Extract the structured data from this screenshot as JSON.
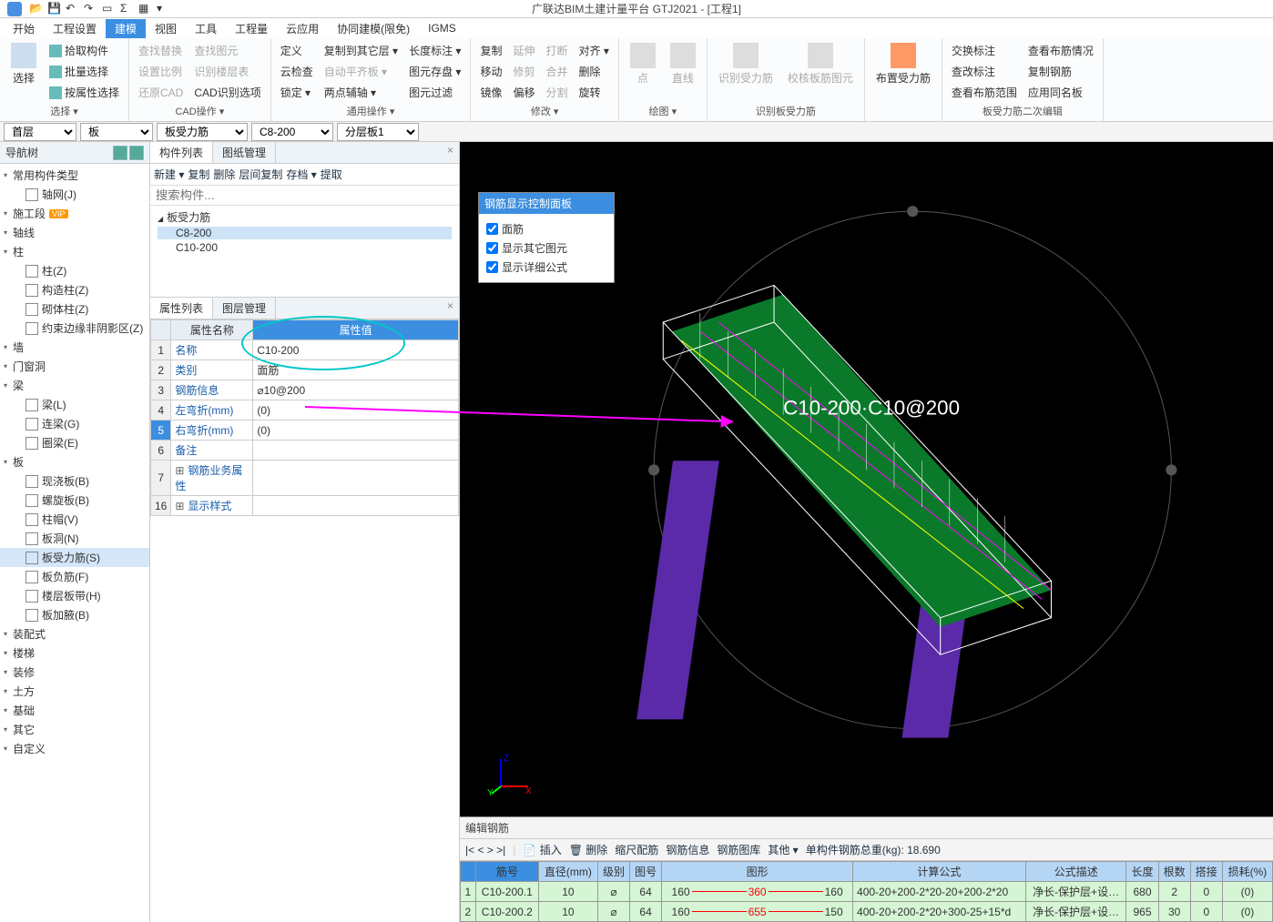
{
  "app": {
    "title": "广联达BIM土建计量平台 GTJ2021 - [工程1]"
  },
  "menus": [
    "开始",
    "工程设置",
    "建模",
    "视图",
    "工具",
    "工程量",
    "云应用",
    "协同建模(限免)",
    "IGMS"
  ],
  "menu_active": 2,
  "ribbon": {
    "select": {
      "big": "选择",
      "items": [
        "拾取构件",
        "批量选择",
        "按属性选择"
      ],
      "label": "选择 ▾"
    },
    "cad": {
      "items": [
        "查找替换",
        "设置比例",
        "还原CAD",
        "查找图元",
        "识别楼层表",
        "CAD识别选项"
      ],
      "label": "CAD操作 ▾"
    },
    "general": {
      "items": [
        "定义",
        "云检查",
        "锁定 ▾",
        "复制到其它层 ▾",
        "自动平齐板 ▾",
        "两点辅轴 ▾",
        "长度标注 ▾",
        "图元存盘 ▾",
        "图元过滤"
      ],
      "label": "通用操作 ▾"
    },
    "modify": {
      "items": [
        "复制",
        "移动",
        "镜像",
        "延伸",
        "修剪",
        "偏移",
        "打断",
        "合并",
        "分割",
        "对齐 ▾",
        "删除",
        "旋转"
      ],
      "label": "修改 ▾"
    },
    "draw": {
      "items": [
        "点",
        "直线"
      ],
      "label": "绘图 ▾"
    },
    "recog": {
      "items": [
        "识别受力筋",
        "校核板筋图元"
      ],
      "label": "识别板受力筋"
    },
    "layout": {
      "big": "布置受力筋"
    },
    "edit2": {
      "items": [
        "交换标注",
        "查看布筋情况",
        "查改标注",
        "复制钢筋",
        "查看布筋范围",
        "应用同名板"
      ],
      "label": "板受力筋二次编辑"
    }
  },
  "selectors": {
    "floor": "首层",
    "cat": "板",
    "type": "板受力筋",
    "spec": "C8-200",
    "layer": "分层板1"
  },
  "nav": {
    "title": "导航树",
    "groups": [
      {
        "name": "常用构件类型",
        "items": [
          {
            "label": "轴网(J)"
          }
        ]
      },
      {
        "name": "施工段",
        "vip": true,
        "items": []
      },
      {
        "name": "轴线",
        "items": []
      },
      {
        "name": "柱",
        "items": [
          {
            "label": "柱(Z)"
          },
          {
            "label": "构造柱(Z)"
          },
          {
            "label": "砌体柱(Z)"
          },
          {
            "label": "约束边缘非阴影区(Z)"
          }
        ]
      },
      {
        "name": "墙",
        "items": []
      },
      {
        "name": "门窗洞",
        "items": []
      },
      {
        "name": "梁",
        "items": [
          {
            "label": "梁(L)"
          },
          {
            "label": "连梁(G)"
          },
          {
            "label": "圈梁(E)"
          }
        ]
      },
      {
        "name": "板",
        "items": [
          {
            "label": "现浇板(B)"
          },
          {
            "label": "螺旋板(B)"
          },
          {
            "label": "柱帽(V)"
          },
          {
            "label": "板洞(N)"
          },
          {
            "label": "板受力筋(S)",
            "selected": true
          },
          {
            "label": "板负筋(F)"
          },
          {
            "label": "楼层板带(H)"
          },
          {
            "label": "板加腋(B)"
          }
        ]
      },
      {
        "name": "装配式",
        "items": []
      },
      {
        "name": "楼梯",
        "items": []
      },
      {
        "name": "装修",
        "items": []
      },
      {
        "name": "土方",
        "items": []
      },
      {
        "name": "基础",
        "items": []
      },
      {
        "name": "其它",
        "items": []
      },
      {
        "name": "自定义",
        "items": []
      }
    ]
  },
  "complist": {
    "tabs": [
      "构件列表",
      "图纸管理"
    ],
    "toolbar": [
      "新建 ▾",
      "复制",
      "删除",
      "层间复制",
      "存档 ▾",
      "提取"
    ],
    "search_ph": "搜索构件...",
    "parent": "板受力筋",
    "children": [
      "C8-200",
      "C10-200"
    ],
    "selected": 0
  },
  "props": {
    "tabs": [
      "属性列表",
      "图层管理"
    ],
    "header": [
      "属性名称",
      "属性值"
    ],
    "rows": [
      {
        "n": "1",
        "name": "名称",
        "val": "C10-200"
      },
      {
        "n": "2",
        "name": "类别",
        "val": "面筋"
      },
      {
        "n": "3",
        "name": "钢筋信息",
        "val": "⌀10@200"
      },
      {
        "n": "4",
        "name": "左弯折(mm)",
        "val": "(0)"
      },
      {
        "n": "5",
        "name": "右弯折(mm)",
        "val": "(0)",
        "sel": true
      },
      {
        "n": "6",
        "name": "备注",
        "val": ""
      },
      {
        "n": "7",
        "name": "钢筋业务属性",
        "val": "",
        "expand": true
      },
      {
        "n": "16",
        "name": "显示样式",
        "val": "",
        "expand": true
      }
    ]
  },
  "ctrlpanel": {
    "title": "钢筋显示控制面板",
    "opts": [
      "面筋",
      "显示其它图元",
      "显示详细公式"
    ]
  },
  "viewport_label": "C10-200·C10@200",
  "rebar_edit": {
    "title": "编辑钢筋",
    "tools": {
      "nav": "|< < > >|",
      "insert": "插入",
      "del": "删除",
      "scale": "缩尺配筋",
      "info": "钢筋信息",
      "lib": "钢筋图库",
      "other": "其他 ▾",
      "total_label": "单构件钢筋总重(kg):",
      "total": "18.690"
    },
    "headers": [
      "筋号",
      "直径(mm)",
      "级别",
      "图号",
      "图形",
      "计算公式",
      "公式描述",
      "长度",
      "根数",
      "搭接",
      "损耗(%)"
    ],
    "rows": [
      {
        "no": "1",
        "id": "C10-200.1",
        "d": "10",
        "lvl": "⌀",
        "fig": "64",
        "s1": "160",
        "s2": "360",
        "s3": "160",
        "formula": "400-20+200-2*20-20+200-2*20",
        "desc": "净长-保护层+设…",
        "len": "680",
        "cnt": "2",
        "lap": "0",
        "loss": "(0)"
      },
      {
        "no": "2",
        "id": "C10-200.2",
        "d": "10",
        "lvl": "⌀",
        "fig": "64",
        "s1": "160",
        "s2": "655",
        "s3": "150",
        "formula": "400-20+200-2*20+300-25+15*d",
        "desc": "净长-保护层+设…",
        "len": "965",
        "cnt": "30",
        "lap": "0",
        "loss": "(0)"
      }
    ]
  }
}
